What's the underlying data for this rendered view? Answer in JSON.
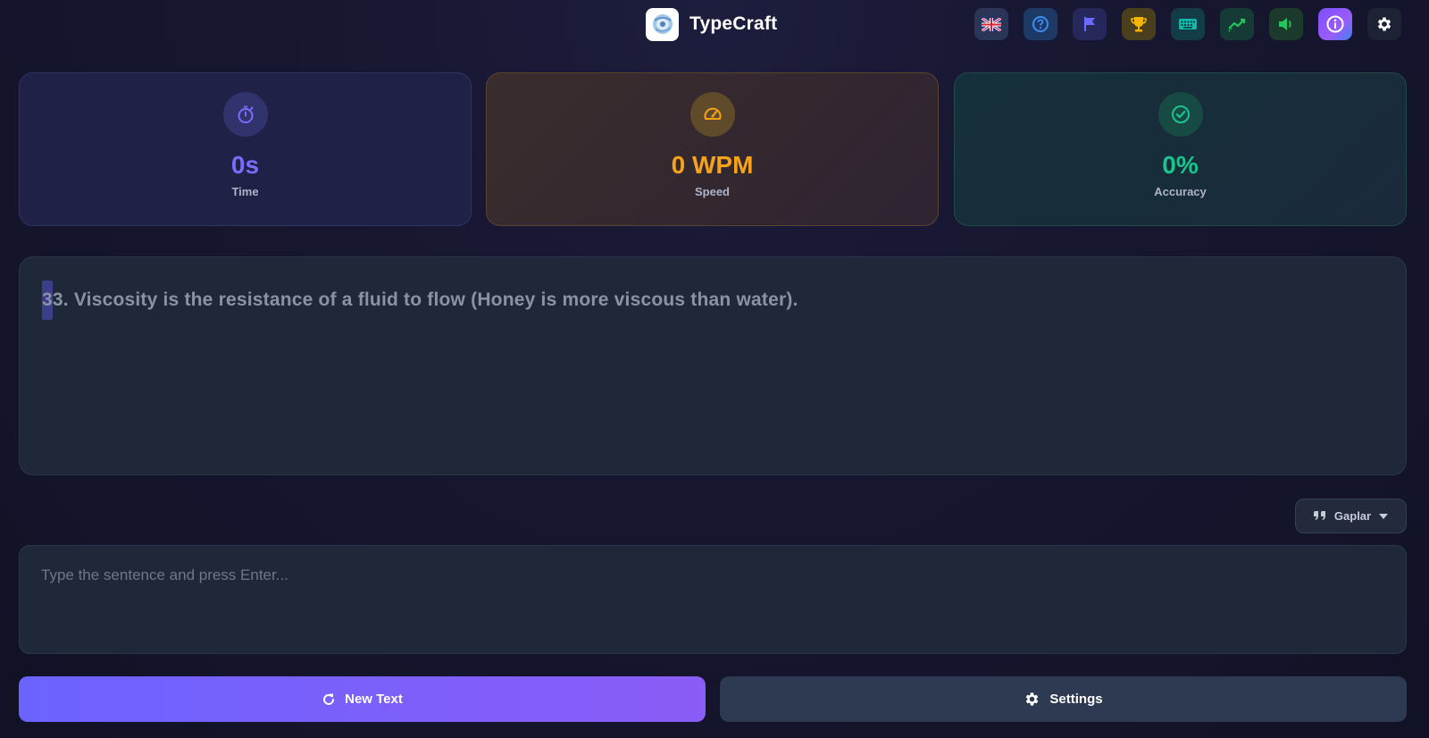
{
  "app": {
    "title": "TypeCraft"
  },
  "toolbar": {
    "icons": [
      {
        "name": "language-flag-icon",
        "color": "#2a3558"
      },
      {
        "name": "help-icon",
        "color": "#1d3a66"
      },
      {
        "name": "flag-icon",
        "color": "#26285c"
      },
      {
        "name": "trophy-icon",
        "color": "#4a3f1d"
      },
      {
        "name": "keyboard-icon",
        "color": "#123d48"
      },
      {
        "name": "chart-trend-icon",
        "color": "#163b36"
      },
      {
        "name": "volume-icon",
        "color": "#1b3a2c"
      },
      {
        "name": "info-icon",
        "color": "#8b5cf6"
      },
      {
        "name": "gear-icon",
        "color": "#1d2234"
      }
    ]
  },
  "stats": {
    "time": {
      "value": "0s",
      "label": "Time",
      "color": "#7b6cff"
    },
    "speed": {
      "value": "0 WPM",
      "label": "Speed",
      "color": "#f7a21b"
    },
    "accuracy": {
      "value": "0%",
      "label": "Accuracy",
      "color": "#19c48f"
    }
  },
  "sentence": {
    "current_char": "3",
    "remaining": "3. Viscosity is the resistance of a fluid to flow (Honey is more viscous than water)."
  },
  "mode": {
    "label": "Gaplar"
  },
  "input": {
    "placeholder": "Type the sentence and press Enter..."
  },
  "actions": {
    "new_text_label": "New Text",
    "settings_label": "Settings"
  }
}
